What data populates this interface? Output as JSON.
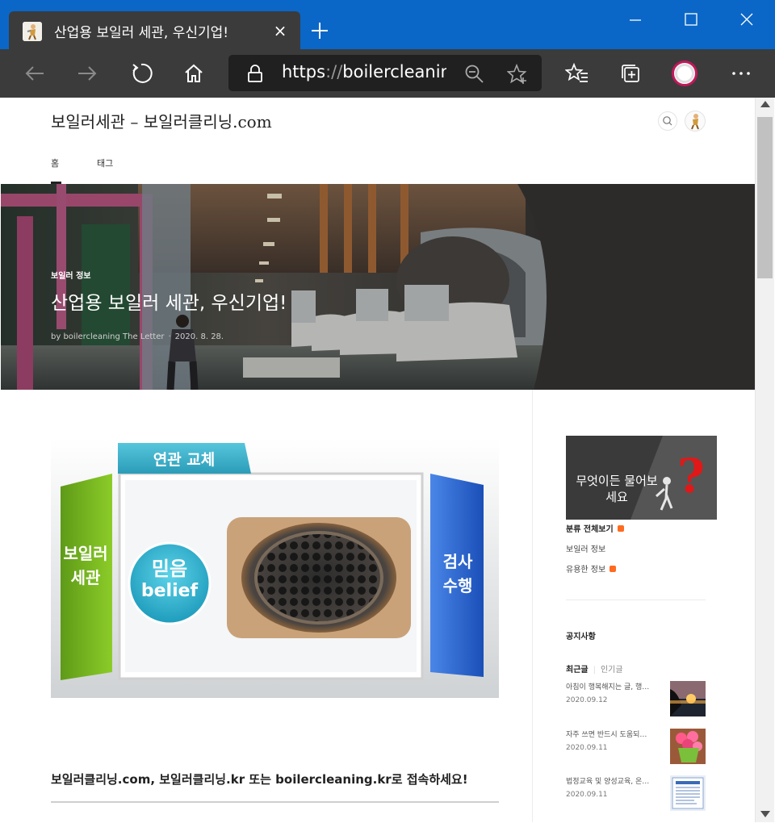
{
  "browser": {
    "tab_title": "산업용 보일러 세관, 우신기업!",
    "url_scheme": "https",
    "url_sep": "://",
    "url_rest": "boilercleaning.com",
    "tab_close": "×"
  },
  "site": {
    "title": "보일러세관 – 보일러클리닝.com",
    "nav": [
      "홈",
      "태그"
    ]
  },
  "hero": {
    "category": "보일러 정보",
    "title": "산업용 보일러 세관, 우신기업!",
    "author": "by boilercleaning The Letter",
    "date": "2020. 8. 28."
  },
  "post_image": {
    "tab_label": "연관 교체",
    "left_panel": "보일러\n세관",
    "circle_ko": "믿음",
    "circle_en": "belief",
    "right_panel": "검사\n수행"
  },
  "post": {
    "text": "보일러클리닝.com, 보일러클리닝.kr 또는 boilercleaning.kr로 접속하세요!"
  },
  "sidebar": {
    "banner_text": "무엇이든 물어보세요",
    "category_all": "분류 전체보기",
    "categories": [
      "보일러 정보",
      "유용한 정보"
    ],
    "notice": "공지사항",
    "recent_tab": "최근글",
    "popular_tab": "인기글",
    "recent": [
      {
        "title": "아침이 행복해지는 글, 행…",
        "date": "2020.09.12"
      },
      {
        "title": "자주 쓰면 반드시 도움되…",
        "date": "2020.09.11"
      },
      {
        "title": "법정교육 및 양성교육, 온…",
        "date": "2020.09.11"
      }
    ]
  },
  "colors": {
    "titlebar": "#0a67c7",
    "toolbar": "#3b3b3b",
    "accent_badge": "#ff6b20"
  },
  "icons": [
    "back-icon",
    "forward-icon",
    "refresh-icon",
    "home-icon",
    "lock-icon",
    "zoom-out-icon",
    "add-favorite-icon",
    "favorites-icon",
    "collections-icon",
    "profile-icon",
    "more-icon",
    "search-icon",
    "minimize-icon",
    "maximize-icon",
    "close-icon"
  ]
}
